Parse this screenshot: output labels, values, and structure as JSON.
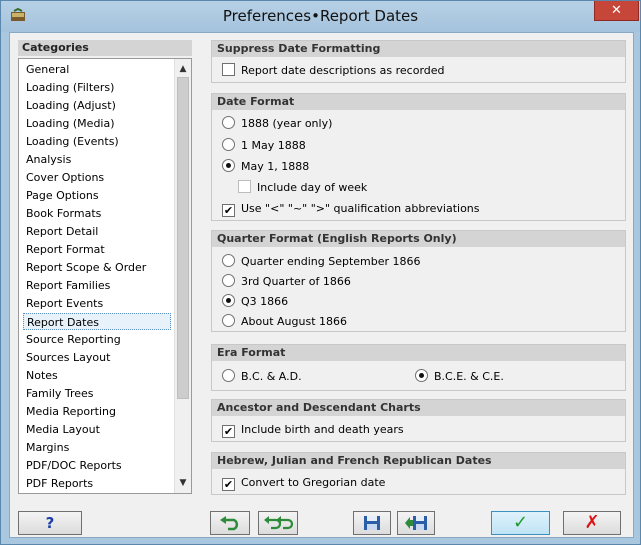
{
  "window": {
    "title": "Preferences•Report Dates",
    "close_label": "✕"
  },
  "categories": {
    "header": "Categories",
    "selected": "Report Dates",
    "items": [
      "General",
      "Loading (Filters)",
      "Loading (Adjust)",
      "Loading (Media)",
      "Loading (Events)",
      "Analysis",
      "Cover Options",
      "Page Options",
      "Book Formats",
      "Report Detail",
      "Report Format",
      "Report Scope & Order",
      "Report Families",
      "Report Events",
      "Report Dates",
      "Source Reporting",
      "Sources Layout",
      "Notes",
      "Family Trees",
      "Media Reporting",
      "Media Layout",
      "Margins",
      "PDF/DOC Reports",
      "PDF Reports"
    ]
  },
  "suppress": {
    "header": "Suppress Date Formatting",
    "option": {
      "label": "Report date descriptions as recorded",
      "checked": false
    }
  },
  "date_format": {
    "header": "Date Format",
    "options": [
      {
        "label": "1888 (year only)",
        "selected": false
      },
      {
        "label": "1 May 1888",
        "selected": false
      },
      {
        "label": "May 1, 1888",
        "selected": true
      }
    ],
    "include_day": {
      "label": "Include day of week",
      "checked": false
    },
    "qualification": {
      "label": "Use \"<\" \"~\" \">\" qualification abbreviations",
      "checked": true
    }
  },
  "quarter_format": {
    "header": "Quarter Format (English Reports Only)",
    "options": [
      {
        "label": "Quarter ending September 1866",
        "selected": false
      },
      {
        "label": "3rd Quarter of 1866",
        "selected": false
      },
      {
        "label": "Q3 1866",
        "selected": true
      },
      {
        "label": "About August 1866",
        "selected": false
      }
    ]
  },
  "era_format": {
    "header": "Era Format",
    "options": [
      {
        "label": "B.C. & A.D.",
        "selected": false
      },
      {
        "label": "B.C.E. & C.E.",
        "selected": true
      }
    ]
  },
  "charts": {
    "header": "Ancestor and Descendant Charts",
    "option": {
      "label": "Include birth and death years",
      "checked": true
    }
  },
  "hebrew": {
    "header": "Hebrew, Julian and French Republican Dates",
    "option": {
      "label": "Convert to Gregorian date",
      "checked": true
    }
  },
  "buttons": {
    "help": "?",
    "ok": "✓",
    "cancel": "✗"
  },
  "colors": {
    "titlebar": "#a9c8e0",
    "accent": "#3c8fc1",
    "ok_check": "#1f9a2a",
    "cancel_x": "#dd1111"
  }
}
